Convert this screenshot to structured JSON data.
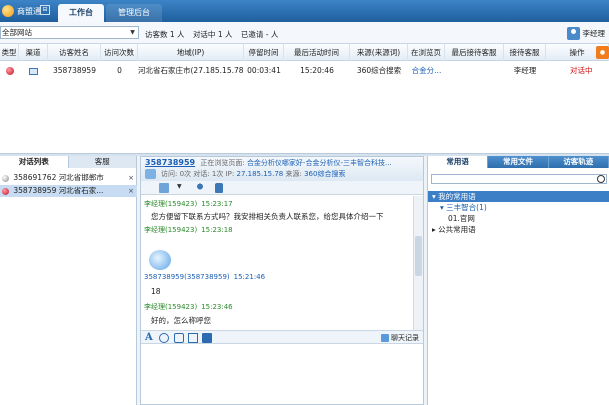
{
  "topbar": {
    "logo_text": "商盟通",
    "minimize": "⊟",
    "tabs": [
      {
        "label": "工作台",
        "active": true
      },
      {
        "label": "管理后台",
        "active": false
      }
    ]
  },
  "filter": {
    "site": "全部网站",
    "visitor_count": "访客数 1 人",
    "chatting": "对话中 1 人",
    "invited": "已邀请 - 人",
    "user": "李经理"
  },
  "table": {
    "headers": [
      "类型",
      "渠道",
      "访客姓名",
      "访问次数",
      "地域(IP)",
      "停留时间",
      "最后活动时间",
      "来源(来源词)",
      "在浏览页",
      "最后接待客服",
      "接待客服",
      "操作"
    ],
    "row": {
      "name": "358738959",
      "visits": "0",
      "region": "河北省石家庄市(27.185.15.78)",
      "stay": "00:03:41",
      "last_active": "15:20:46",
      "source": "360综合搜索",
      "page": "合金分...",
      "prev_service": "",
      "service": "李经理",
      "op": "对话中"
    }
  },
  "left_panel": {
    "tabs": [
      "对话列表",
      "客服"
    ],
    "items": [
      {
        "label": "358691762 河北省邯郸市",
        "selected": false
      },
      {
        "label": "358738959 河北省石家...",
        "selected": true
      }
    ],
    "close": "×"
  },
  "chat": {
    "visitor_id": "358738959",
    "viewing_label": "正在浏览页面:",
    "viewing_page": "合金分析仪哪家好-合金分析仪-三丰智合科技...",
    "visit_label": "访问:",
    "visit_val": "0次",
    "dialog_label": "对话:",
    "dialog_val": "1次",
    "ip_label": "IP:",
    "ip": "27.185.15.78",
    "source_label": "来源:",
    "source": "360综合搜索",
    "messages": [
      {
        "sender": "李经理",
        "sid": "(159423)",
        "time": "15:23:17",
        "text": "您方便留下联系方式吗？我安排相关负责人联系您，给您具体介绍一下",
        "kind": "staff"
      },
      {
        "sender": "李经理",
        "sid": "(159423)",
        "time": "15:23:18",
        "text": "",
        "kind": "staff"
      },
      {
        "sender": "358738959",
        "sid": "(358738959)",
        "time": "15:21:46",
        "text": "18",
        "kind": "visitor"
      },
      {
        "sender": "李经理",
        "sid": "(159423)",
        "time": "15:23:46",
        "text": "好的，怎么称呼您",
        "kind": "staff"
      }
    ],
    "history": "聊天记录"
  },
  "right_panel": {
    "tabs": [
      "常用语",
      "常用文件",
      "访客轨迹"
    ],
    "tree": {
      "my": "我的常用语",
      "group": "三丰智合(1)",
      "item": "01.官网",
      "public": "公共常用语"
    }
  }
}
